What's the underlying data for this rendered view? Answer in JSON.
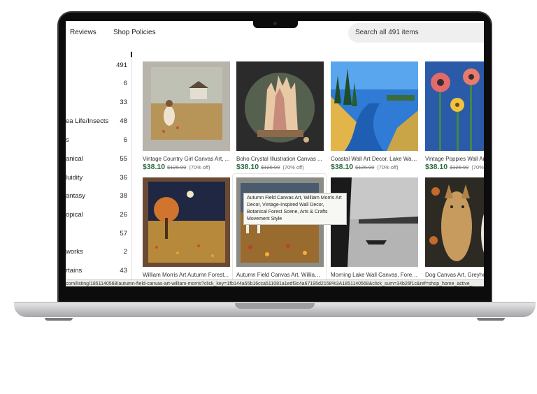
{
  "header": {
    "reviews_link": "Reviews",
    "policies_link": "Shop Policies",
    "search_text": "Search all 491 items"
  },
  "sidebar": {
    "items": [
      {
        "label": "",
        "count": "491"
      },
      {
        "label": "",
        "count": "6"
      },
      {
        "label": "",
        "count": "33"
      },
      {
        "label": "ea Life/Insects",
        "count": "48"
      },
      {
        "label": "s",
        "count": "6"
      },
      {
        "label": "anical",
        "count": "55"
      },
      {
        "label": "luidity",
        "count": "36"
      },
      {
        "label": "antasy",
        "count": "38"
      },
      {
        "label": "opical",
        "count": "26"
      },
      {
        "label": "",
        "count": "57"
      },
      {
        "label": "works",
        "count": "2"
      },
      {
        "label": "rtains",
        "count": "43"
      }
    ]
  },
  "listings": [
    {
      "title": "Vintage Country Girl Canvas Art, ...",
      "price": "$38.10",
      "old_price": "$126.99",
      "discount": "(70% off)"
    },
    {
      "title": "Boho Crystal Illustration Canvas ...",
      "price": "$38.10",
      "old_price": "$126.99",
      "discount": "(70% off)"
    },
    {
      "title": "Coastal Wall Art Decor, Lake Wall ...",
      "price": "$38.10",
      "old_price": "$126.99",
      "discount": "(70% off)"
    },
    {
      "title": "Vintage Poppies Wall Ar...",
      "price": "$38.10",
      "old_price": "$126.99",
      "discount": "(70%"
    },
    {
      "title": "William Morris Art Autumn Forest...",
      "price": "",
      "old_price": "",
      "discount": ""
    },
    {
      "title": "Autumn Field Canvas Art, William...",
      "price": "",
      "old_price": "",
      "discount": ""
    },
    {
      "title": "Morning Lake Wall Canvas, Forest...",
      "price": "",
      "old_price": "",
      "discount": ""
    },
    {
      "title": "Dog Canvas Art, Greyho...",
      "price": "",
      "old_price": "",
      "discount": ""
    }
  ],
  "tooltip": "Autumn Field Canvas Art, William Morris Art Decor, Vintage-Inspired Wall Decor, Botanical Forest Scene, Arts & Crafts Movement Style",
  "status_url": "com/listing/1851140568/autumn-field-canvas-art-william-morris?click_key=1fb144a55b16cca511081a1edf3c4a67195d2158%3A1851140568&click_sum=34b26f1c&ref=shop_home_active_",
  "colors": {
    "price_green": "#2a6b3f",
    "search_bg": "#efefef"
  }
}
